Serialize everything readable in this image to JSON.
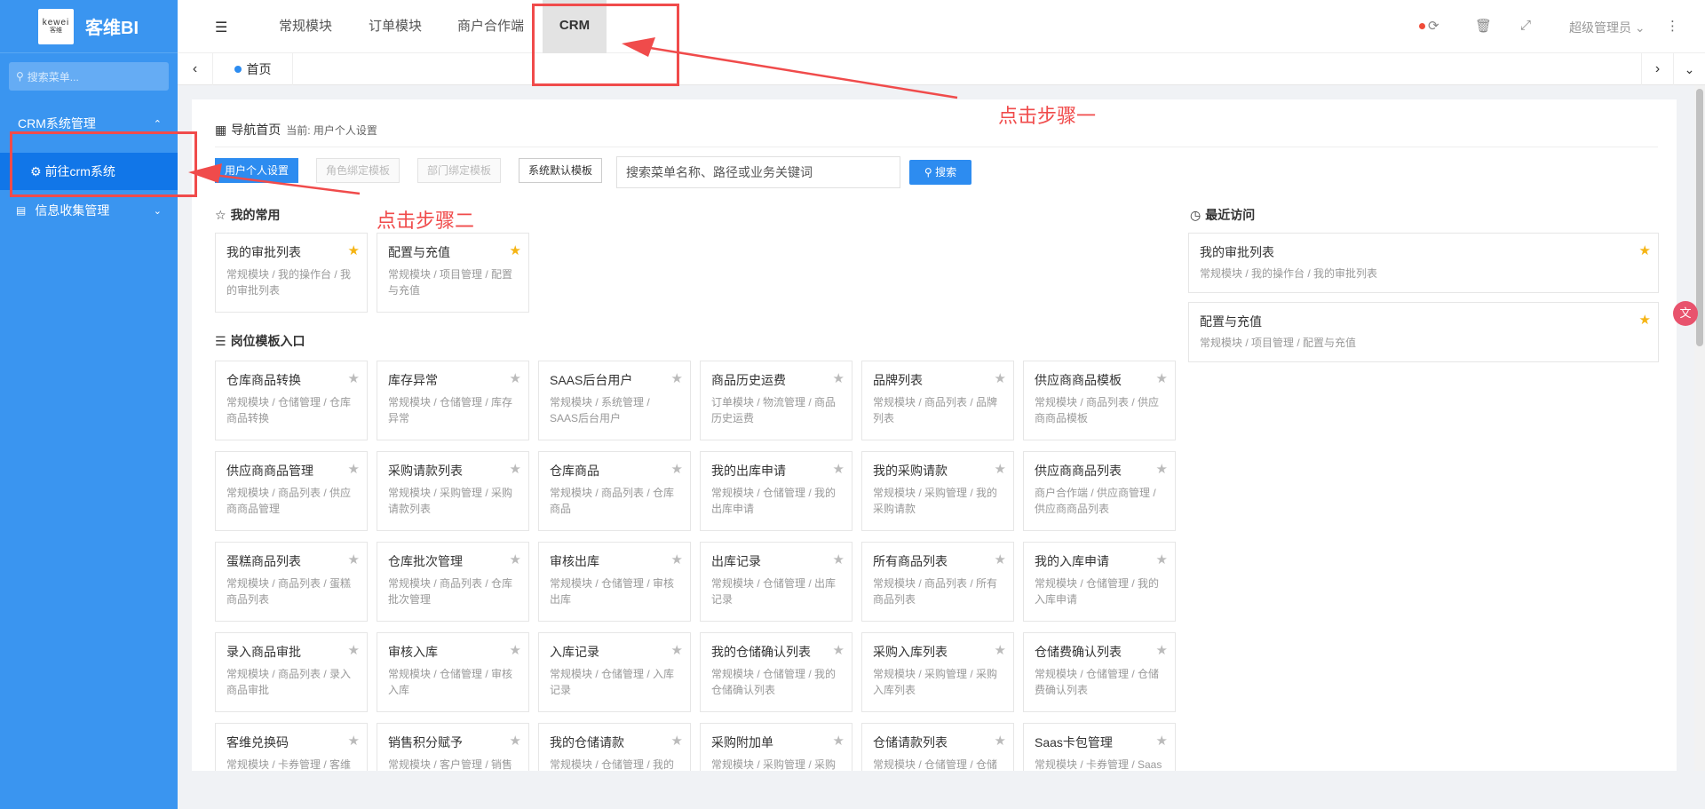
{
  "sidebar": {
    "logo_text": "kewei",
    "logo_sub": "客维",
    "title": "客维BI",
    "search_placeholder": "搜索菜单...",
    "groups": [
      {
        "label": "CRM系统管理",
        "chevron": "chevron-up-icon",
        "items": [
          {
            "label": "前往crm系统",
            "icon": "gear-icon"
          }
        ]
      },
      {
        "label": "信息收集管理",
        "chevron": "chevron-down-icon",
        "icon": "form-icon",
        "items": []
      }
    ]
  },
  "header": {
    "tabs": [
      "常规模块",
      "订单模块",
      "商户合作端",
      "CRM"
    ],
    "active_tab": "CRM",
    "user": "超级管理员",
    "icons": [
      "menu-toggle-icon",
      "refresh-icon",
      "trash-icon",
      "fullscreen-icon",
      "more-vertical-icon"
    ]
  },
  "tabsbar": {
    "home": "首页"
  },
  "main": {
    "nav_title": "导航首页",
    "nav_current": "当前: 用户个人设置",
    "mode_buttons": [
      "用户个人设置",
      "角色绑定模板",
      "部门绑定模板",
      "系统默认模板"
    ],
    "search_placeholder": "搜索菜单名称、路径或业务关键词",
    "search_btn": "搜索",
    "favorites_title": "我的常用",
    "favorites": [
      {
        "title": "我的审批列表",
        "path": "常规模块 / 我的操作台 / 我的审批列表",
        "starred": true
      },
      {
        "title": "配置与充值",
        "path": "常规模块 / 项目管理 / 配置与充值",
        "starred": true
      }
    ],
    "recent_title": "最近访问",
    "recent": [
      {
        "title": "我的审批列表",
        "path": "常规模块 / 我的操作台 / 我的审批列表",
        "starred": true
      },
      {
        "title": "配置与充值",
        "path": "常规模块 / 项目管理 / 配置与充值",
        "starred": true
      }
    ],
    "templates_title": "岗位模板入口",
    "templates": [
      {
        "title": "仓库商品转换",
        "path": "常规模块 / 仓储管理 / 仓库商品转换"
      },
      {
        "title": "库存异常",
        "path": "常规模块 / 仓储管理 / 库存异常"
      },
      {
        "title": "SAAS后台用户",
        "path": "常规模块 / 系统管理 / SAAS后台用户"
      },
      {
        "title": "商品历史运费",
        "path": "订单模块 / 物流管理 / 商品历史运费"
      },
      {
        "title": "品牌列表",
        "path": "常规模块 / 商品列表 / 品牌列表"
      },
      {
        "title": "供应商商品模板",
        "path": "常规模块 / 商品列表 / 供应商商品模板"
      },
      {
        "title": "供应商商品管理",
        "path": "常规模块 / 商品列表 / 供应商商品管理"
      },
      {
        "title": "采购请款列表",
        "path": "常规模块 / 采购管理 / 采购请款列表"
      },
      {
        "title": "仓库商品",
        "path": "常规模块 / 商品列表 / 仓库商品"
      },
      {
        "title": "我的出库申请",
        "path": "常规模块 / 仓储管理 / 我的出库申请"
      },
      {
        "title": "我的采购请款",
        "path": "常规模块 / 采购管理 / 我的采购请款"
      },
      {
        "title": "供应商商品列表",
        "path": "商户合作端 / 供应商管理 / 供应商商品列表"
      },
      {
        "title": "蛋糕商品列表",
        "path": "常规模块 / 商品列表 / 蛋糕商品列表"
      },
      {
        "title": "仓库批次管理",
        "path": "常规模块 / 商品列表 / 仓库批次管理"
      },
      {
        "title": "审核出库",
        "path": "常规模块 / 仓储管理 / 审核出库"
      },
      {
        "title": "出库记录",
        "path": "常规模块 / 仓储管理 / 出库记录"
      },
      {
        "title": "所有商品列表",
        "path": "常规模块 / 商品列表 / 所有商品列表"
      },
      {
        "title": "我的入库申请",
        "path": "常规模块 / 仓储管理 / 我的入库申请"
      },
      {
        "title": "录入商品审批",
        "path": "常规模块 / 商品列表 / 录入商品审批"
      },
      {
        "title": "审核入库",
        "path": "常规模块 / 仓储管理 / 审核入库"
      },
      {
        "title": "入库记录",
        "path": "常规模块 / 仓储管理 / 入库记录"
      },
      {
        "title": "我的仓储确认列表",
        "path": "常规模块 / 仓储管理 / 我的仓储确认列表"
      },
      {
        "title": "采购入库列表",
        "path": "常规模块 / 采购管理 / 采购入库列表"
      },
      {
        "title": "仓储费确认列表",
        "path": "常规模块 / 仓储管理 / 仓储费确认列表"
      },
      {
        "title": "客维兑换码",
        "path": "常规模块 / 卡券管理 / 客维兑换码"
      },
      {
        "title": "销售积分赋予",
        "path": "常规模块 / 客户管理 / 销售积分赋予"
      },
      {
        "title": "我的仓储请款",
        "path": "常规模块 / 仓储管理 / 我的仓储请款"
      },
      {
        "title": "采购附加单",
        "path": "常规模块 / 采购管理 / 采购附加单"
      },
      {
        "title": "仓储请款列表",
        "path": "常规模块 / 仓储管理 / 仓储请款列表"
      },
      {
        "title": "Saas卡包管理",
        "path": "常规模块 / 卡券管理 / Saas卡包管理"
      }
    ]
  },
  "annotations": {
    "step1": "点击步骤一",
    "step2": "点击步骤二"
  },
  "colors": {
    "sidebar": "#3a95f0",
    "sidebar_active": "#1176e8",
    "primary": "#2d8cf0",
    "star_on": "#f5b414",
    "annotation": "#f04b4b"
  }
}
